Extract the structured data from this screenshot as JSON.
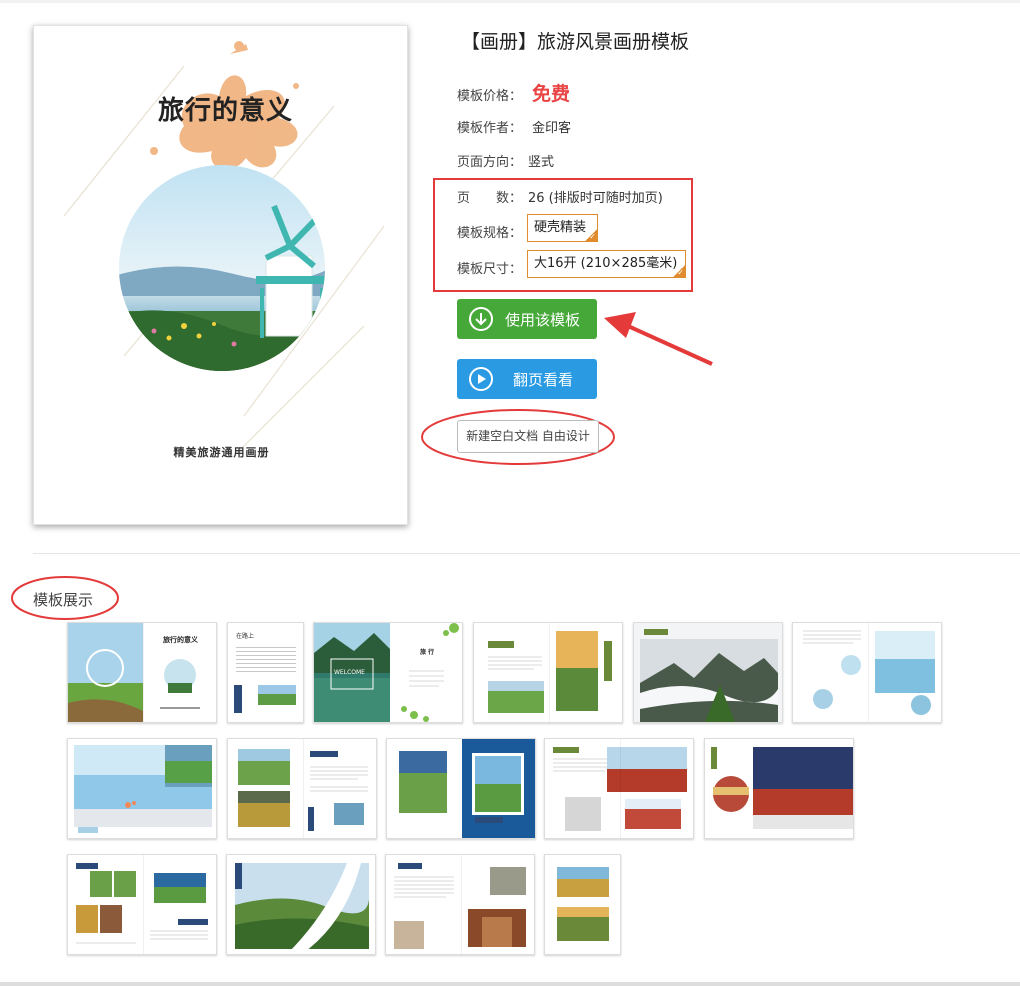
{
  "template": {
    "title": "【画册】旅游风景画册模板",
    "price_label": "模板价格：",
    "price_value": "免费",
    "author_label": "模板作者：",
    "author_value": "金印客",
    "orientation_label": "页面方向：",
    "orientation_value": "竖式",
    "pages_label": "页　　数：",
    "pages_value": "26 (排版时可随时加页)",
    "spec_label": "模板规格：",
    "spec_value": "硬壳精装",
    "size_label": "模板尺寸：",
    "size_value": "大16开 (210×285毫米)"
  },
  "cover": {
    "title": "旅行的意义",
    "subtitle": "精美旅游通用画册"
  },
  "actions": {
    "use_template": "使用该模板",
    "flip_preview": "翻页看看",
    "new_blank": "新建空白文档 自由设计"
  },
  "gallery": {
    "section_title": "模板展示",
    "rows": [
      {
        "count": 6
      },
      {
        "count": 5
      },
      {
        "count": 4
      }
    ],
    "thumb_labels": {
      "t1_title": "旅行的意义",
      "t2_title": "在路上",
      "t3_title": "旅 行",
      "t3_welcome": "WELCOME"
    }
  },
  "colors": {
    "accent_red": "#e43a3a",
    "option_orange": "#e08b2e",
    "button_green": "#47a83a",
    "button_blue": "#2a9be3",
    "price_red": "#e94444"
  },
  "icons": {
    "use_template": "download-circle-icon",
    "flip_preview": "play-circle-icon",
    "option_check": "check-corner-icon"
  }
}
